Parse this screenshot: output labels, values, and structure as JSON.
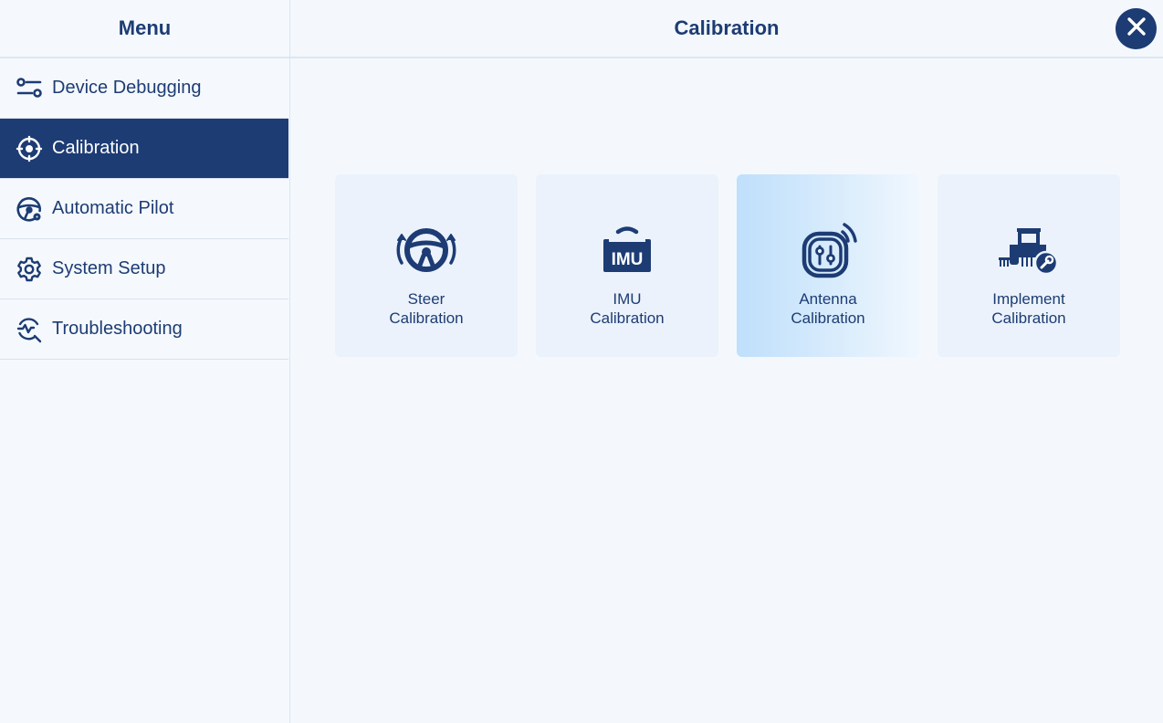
{
  "sidebar": {
    "title": "Menu",
    "items": [
      {
        "label": "Device Debugging",
        "icon": "sliders-icon"
      },
      {
        "label": "Calibration",
        "icon": "crosshair-icon",
        "active": true
      },
      {
        "label": "Automatic Pilot",
        "icon": "steering-wheel-gear-icon"
      },
      {
        "label": "System Setup",
        "icon": "gear-icon"
      },
      {
        "label": "Troubleshooting",
        "icon": "magnifier-pulse-icon"
      }
    ]
  },
  "header": {
    "title": "Calibration",
    "close_icon": "close-icon"
  },
  "cards": [
    {
      "line1": "Steer",
      "line2": "Calibration",
      "icon": "steering-wheel-icon"
    },
    {
      "line1": "IMU",
      "line2": "Calibration",
      "icon": "imu-icon",
      "icon_text": "IMU"
    },
    {
      "line1": "Antenna",
      "line2": "Calibration",
      "icon": "antenna-icon",
      "selected": true
    },
    {
      "line1": "Implement",
      "line2": "Calibration",
      "icon": "tractor-wrench-icon"
    }
  ],
  "colors": {
    "primary": "#1d3c74",
    "background": "#f4f8fd",
    "card": "#ebf2fb",
    "selected_card": "#bfdffb"
  }
}
